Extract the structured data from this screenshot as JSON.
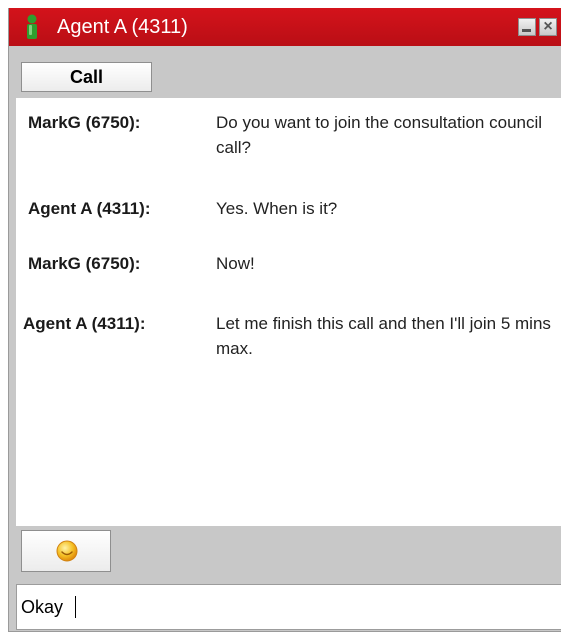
{
  "window": {
    "title": "Agent A (4311)",
    "close_glyph": "×",
    "status_icon": "agent-status-icon",
    "colors": {
      "titlebar": "#c8101a",
      "status_green": "#2e9e2e"
    }
  },
  "toolbar": {
    "call_label": "Call"
  },
  "messages": [
    {
      "sender": "MarkG (6750):",
      "text": "Do you want to join the consultation council call?"
    },
    {
      "sender": "Agent A (4311):",
      "text": "Yes. When is it?"
    },
    {
      "sender": "MarkG (6750):",
      "text": "Now!"
    },
    {
      "sender": "Agent A (4311):",
      "text": "Let me finish this call and then I'll join 5 mins max."
    }
  ],
  "composer": {
    "emoji_icon": "smiley-icon",
    "input_value": "Okay"
  }
}
